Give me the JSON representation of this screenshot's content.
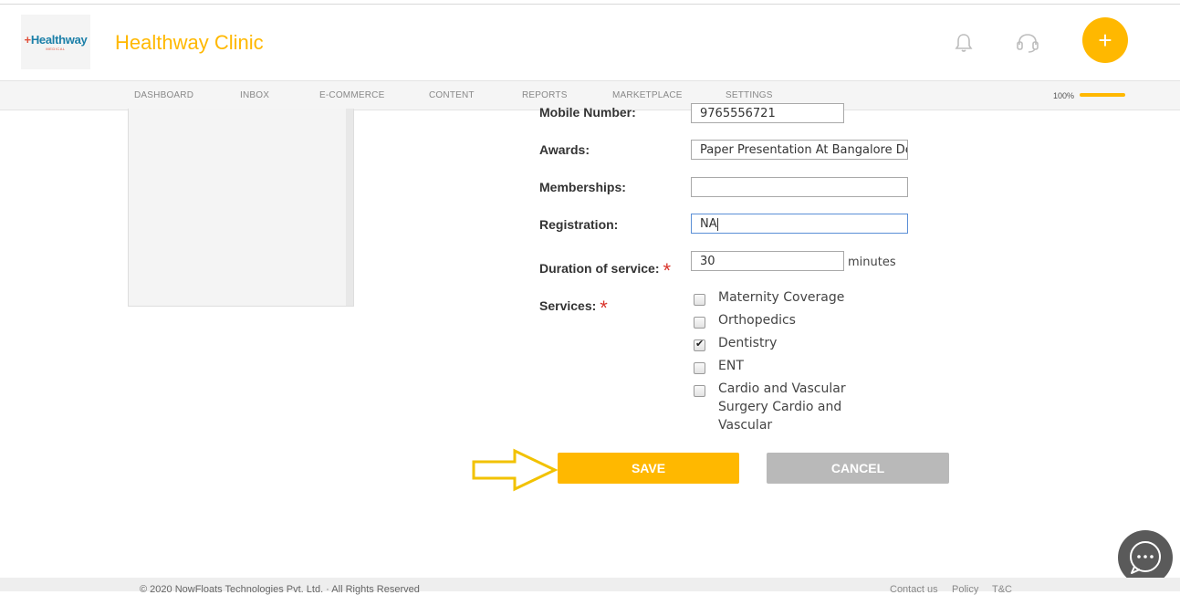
{
  "header": {
    "logo_text": "Healthway",
    "logo_sub": "MEDICAL",
    "clinic_name": "Healthway Clinic",
    "add_label": "+"
  },
  "nav": {
    "items": [
      "DASHBOARD",
      "INBOX",
      "E-COMMERCE",
      "CONTENT",
      "REPORTS",
      "MARKETPLACE",
      "SETTINGS"
    ],
    "progress_text": "100%",
    "progress_value": 1.0
  },
  "form": {
    "mobile": {
      "label": "Mobile Number:",
      "value": "9765556721"
    },
    "awards": {
      "label": "Awards:",
      "value": "Paper Presentation At Bangalore Derm"
    },
    "memberships": {
      "label": "Memberships:",
      "value": ""
    },
    "registration": {
      "label": "Registration:",
      "value": "NA"
    },
    "duration": {
      "label": "Duration of service:",
      "value": "30",
      "unit": "minutes",
      "required_mark": "*"
    },
    "services": {
      "label": "Services:",
      "required_mark": "*",
      "options": [
        {
          "label": "Maternity Coverage",
          "checked": false
        },
        {
          "label": "Orthopedics",
          "checked": false
        },
        {
          "label": "Dentistry",
          "checked": true
        },
        {
          "label": "ENT",
          "checked": false
        },
        {
          "label": "Cardio and Vascular Surgery Cardio and Vascular",
          "checked": false
        }
      ]
    },
    "save_label": "SAVE",
    "cancel_label": "CANCEL"
  },
  "footer": {
    "copyright": "© 2020 NowFloats Technologies Pvt. Ltd. · All Rights Reserved",
    "links": [
      "Contact us",
      "Policy",
      "T&C"
    ]
  },
  "colors": {
    "accent": "#ffb800",
    "required": "#d9342b",
    "cancel": "#b9b9b9"
  }
}
